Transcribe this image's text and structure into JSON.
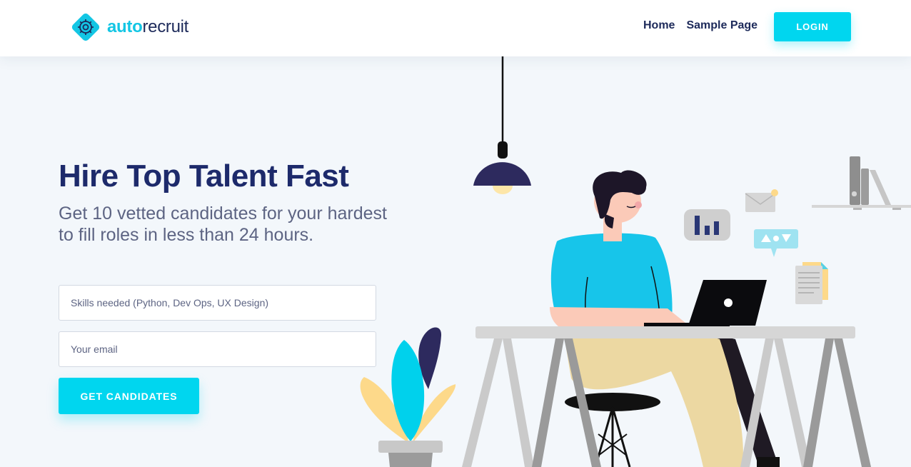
{
  "brand": {
    "name_part1": "auto",
    "name_part2": "recruit",
    "accent_color": "#00d6ef",
    "navy_color": "#1d2a6b"
  },
  "nav": {
    "links": [
      {
        "label": "Home"
      },
      {
        "label": "Sample Page"
      }
    ],
    "login_label": "LOGIN"
  },
  "hero": {
    "title": "Hire Top Talent Fast",
    "subtitle": "Get 10 vetted candidates for your hardest to fill roles in less than 24 hours."
  },
  "form": {
    "skills_placeholder": "Skills needed (Python, Dev Ops, UX Design)",
    "email_placeholder": "Your email",
    "submit_label": "GET CANDIDATES"
  },
  "illustration": {
    "icons": [
      "pendant-lamp-icon",
      "plant-icon",
      "person-at-laptop-icon",
      "bar-chart-icon",
      "envelope-icon",
      "chat-bubble-icon",
      "document-icon",
      "bookshelf-icon"
    ]
  }
}
